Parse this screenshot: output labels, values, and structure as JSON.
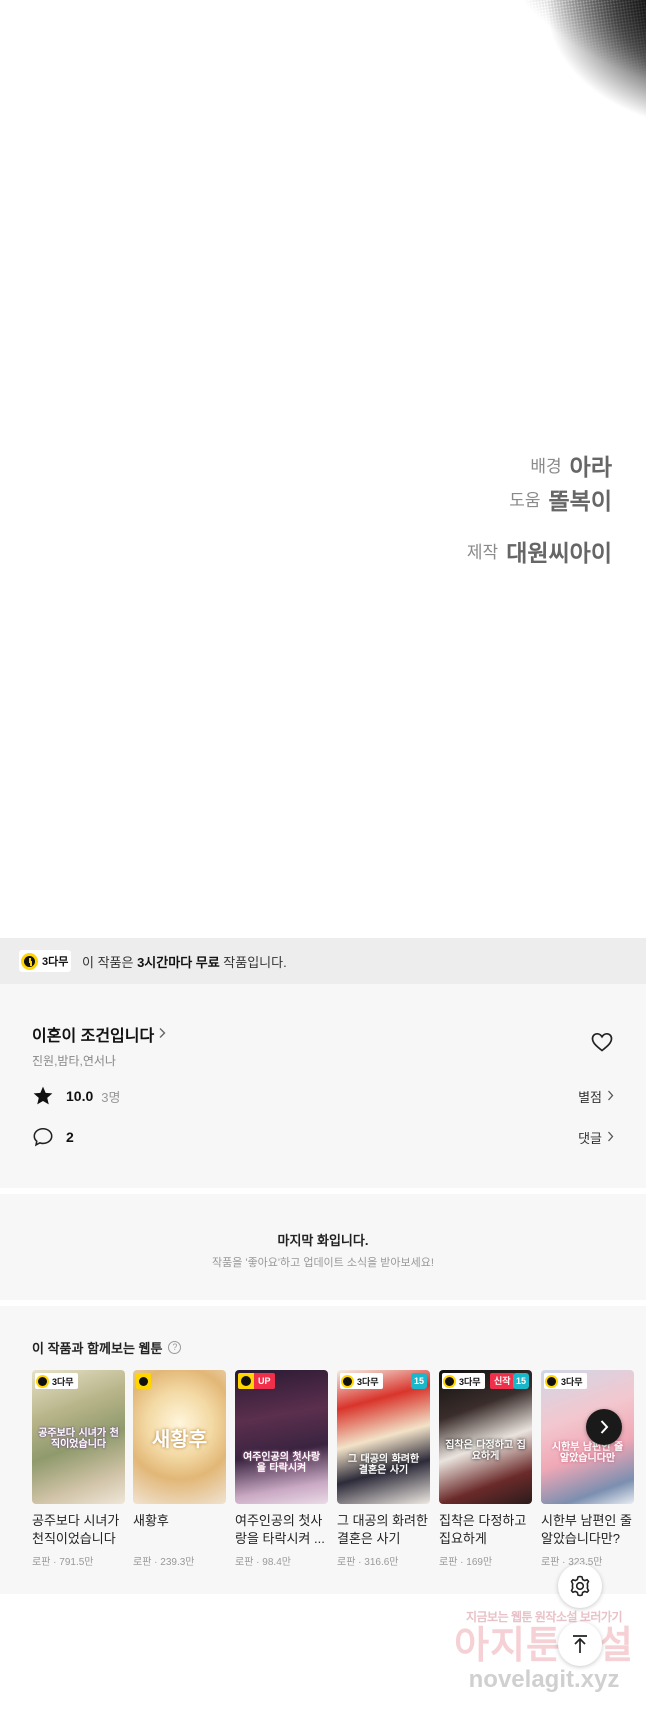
{
  "credits": [
    {
      "role": "배경",
      "name": "아라"
    },
    {
      "role": "도움",
      "name": "똘복이"
    },
    {
      "role": "제작",
      "name": "대원씨아이"
    }
  ],
  "notice": {
    "badge": "3다무",
    "text_prefix": "이 작품은 ",
    "text_bold": "3시간마다 무료",
    "text_suffix": " 작품입니다."
  },
  "series": {
    "title": "이혼이 조건입니다",
    "authors": "진원,밤타,연서나",
    "rating": "10.0",
    "rating_count": "3명",
    "rating_link": "별점",
    "comment_count": "2",
    "comment_link": "댓글"
  },
  "last_episode": {
    "title": "마지막 화입니다.",
    "subtitle": "작품을 '좋아요'하고 업데이트 소식을 받아보세요!"
  },
  "recommend": {
    "heading": "이 작품과 함께보는 웹툰",
    "help": "?",
    "cards": [
      {
        "title": "공주보다 시녀가 천직이었습니다",
        "meta": "로판 · 791.5만",
        "tag": "3다무",
        "cover_text": "공주보다 시녀가 천직이었습니다"
      },
      {
        "title": "새황후",
        "meta": "로판 · 239.3만",
        "tag": "",
        "cover_text": "새황후"
      },
      {
        "title": "여주인공의 첫사랑을 타락시켜 ...",
        "meta": "로판 · 98.4만",
        "tag": "UP",
        "cover_text": "여주인공의 첫사랑을 타락시켜"
      },
      {
        "title": "그 대공의 화려한 결혼은 사기",
        "meta": "로판 · 316.6만",
        "tag": "3다무",
        "badge": "15",
        "cover_text": "그 대공의 화려한 결혼은 사기"
      },
      {
        "title": "집착은 다정하고 집요하게",
        "meta": "로판 · 169만",
        "tag": "3다무",
        "new": "신작",
        "badge": "15",
        "cover_text": "집착은 다정하고 집요하게"
      },
      {
        "title": "시한부 남편인 줄 알았습니다만?",
        "meta": "로판 · 323.5만",
        "tag": "3다무",
        "cover_text": "시한부 남편인 줄 알았습니다만"
      }
    ]
  },
  "watermark": {
    "line1": "지금보는 웹툰 원작소설 보러가기",
    "line2": "아지툰소설",
    "line3": "novelagit.xyz"
  },
  "colors": {
    "accent_yellow": "#ffd600",
    "up_red": "#f0304a",
    "age_teal": "#19b7c9",
    "panel_bg": "#f7f7f7",
    "notice_bg": "#ededed"
  }
}
